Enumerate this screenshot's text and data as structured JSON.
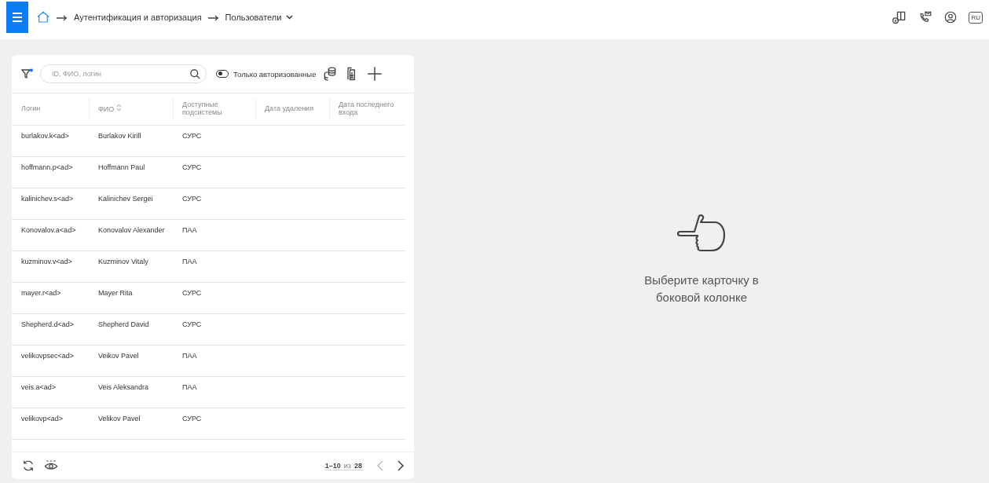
{
  "header": {
    "breadcrumbs": [
      {
        "label": "Аутентификация и авторизация",
        "dropdown": false
      },
      {
        "label": "Пользователи",
        "dropdown": true
      }
    ],
    "language": "RU"
  },
  "toolbar": {
    "search": {
      "placeholder": "ID, ФИО, логин"
    },
    "filter_active": true,
    "toggle": {
      "label": "Только авторизованные",
      "on": false
    }
  },
  "table": {
    "columns": [
      {
        "label": "Логин",
        "sortable": false
      },
      {
        "label": "ФИО",
        "sortable": true
      },
      {
        "label": "Доступные подсистемы",
        "sortable": false
      },
      {
        "label": "Дата удаления",
        "sortable": false
      },
      {
        "label": "Дата последнего входа",
        "sortable": false
      }
    ],
    "rows": [
      [
        "burlakov.k<ad>",
        "Burlakov Kirill",
        "СУРС"
      ],
      [
        "hoffmann.p<ad>",
        "Hoffmann Paul",
        "СУРС"
      ],
      [
        "kalinichev.s<ad>",
        "Kalinichev Sergei",
        "СУРС"
      ],
      [
        "Konovalov.a<ad>",
        "Konovalov Alexander",
        "ПАА"
      ],
      [
        "kuzminov.v<ad>",
        "Kuzminov Vitaly",
        "ПАА"
      ],
      [
        "mayer.r<ad>",
        "Mayer Rita",
        "СУРС"
      ],
      [
        "Shepherd.d<ad>",
        "Shepherd David",
        "СУРС"
      ],
      [
        "velikovpsec<ad>",
        "Veikov Pavel",
        "ПАА"
      ],
      [
        "veis.a<ad>",
        "Veis Aleksandra",
        "ПАА"
      ],
      [
        "velikovp<ad>",
        "Velikov Pavel",
        "СУРС"
      ]
    ]
  },
  "pagination": {
    "range": "1–10",
    "of": "из",
    "total": "28"
  },
  "empty_state": {
    "message": "Выберите карточку в боковой колонке"
  }
}
